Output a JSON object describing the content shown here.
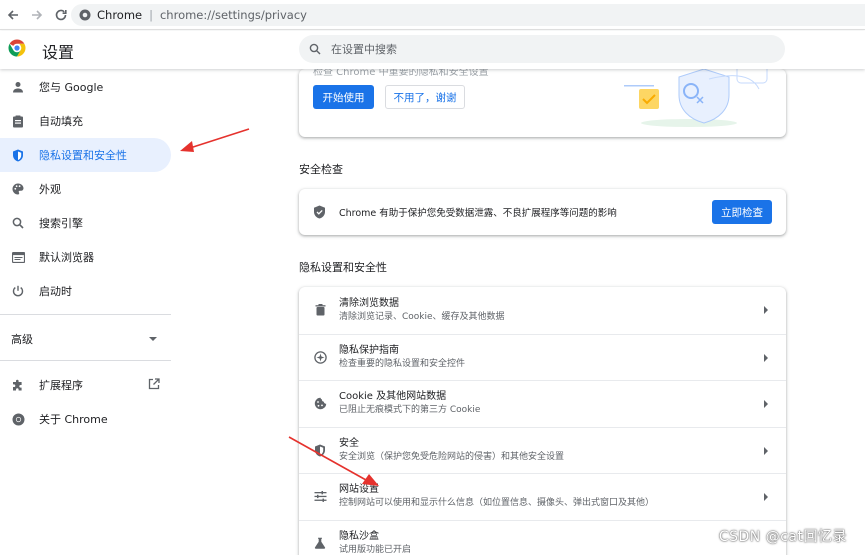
{
  "browser": {
    "site_label": "Chrome",
    "url": "chrome://settings/privacy"
  },
  "header": {
    "title": "设置",
    "search_placeholder": "在设置中搜索"
  },
  "sidebar": {
    "items": [
      {
        "label": "您与 Google",
        "icon": "person-icon"
      },
      {
        "label": "自动填充",
        "icon": "clipboard-icon"
      },
      {
        "label": "隐私设置和安全性",
        "icon": "shield-icon",
        "active": true
      },
      {
        "label": "外观",
        "icon": "palette-icon"
      },
      {
        "label": "搜索引擎",
        "icon": "search-icon"
      },
      {
        "label": "默认浏览器",
        "icon": "browser-icon"
      },
      {
        "label": "启动时",
        "icon": "power-icon"
      }
    ],
    "advanced_label": "高级",
    "extensions_label": "扩展程序",
    "about_label": "关于 Chrome"
  },
  "promo": {
    "faded_text": "检查 Chrome 中重要的隐私和安全设置",
    "start_label": "开始使用",
    "no_thanks_label": "不用了，谢谢"
  },
  "safety_check": {
    "section_title": "安全检查",
    "description": "Chrome 有助于保护您免受数据泄露、不良扩展程序等问题的影响",
    "check_now_label": "立即检查"
  },
  "privacy": {
    "section_title": "隐私设置和安全性",
    "rows": [
      {
        "title": "清除浏览数据",
        "subtitle": "清除浏览记录、Cookie、缓存及其他数据",
        "icon": "trash-icon"
      },
      {
        "title": "隐私保护指南",
        "subtitle": "检查重要的隐私设置和安全控件",
        "icon": "compass-icon"
      },
      {
        "title": "Cookie 及其他网站数据",
        "subtitle": "已阻止无痕模式下的第三方 Cookie",
        "icon": "cookie-icon"
      },
      {
        "title": "安全",
        "subtitle": "安全浏览（保护您免受危险网站的侵害）和其他安全设置",
        "icon": "security-shield-icon"
      },
      {
        "title": "网站设置",
        "subtitle": "控制网站可以使用和显示什么信息（如位置信息、摄像头、弹出式窗口及其他）",
        "icon": "sliders-icon"
      },
      {
        "title": "隐私沙盒",
        "subtitle": "试用版功能已开启",
        "icon": "flask-icon"
      }
    ]
  },
  "watermark": "CSDN @cat回忆录",
  "colors": {
    "accent": "#1a73e8",
    "active_bg": "#e8f0fe",
    "annotation_arrow": "#e5322d"
  }
}
